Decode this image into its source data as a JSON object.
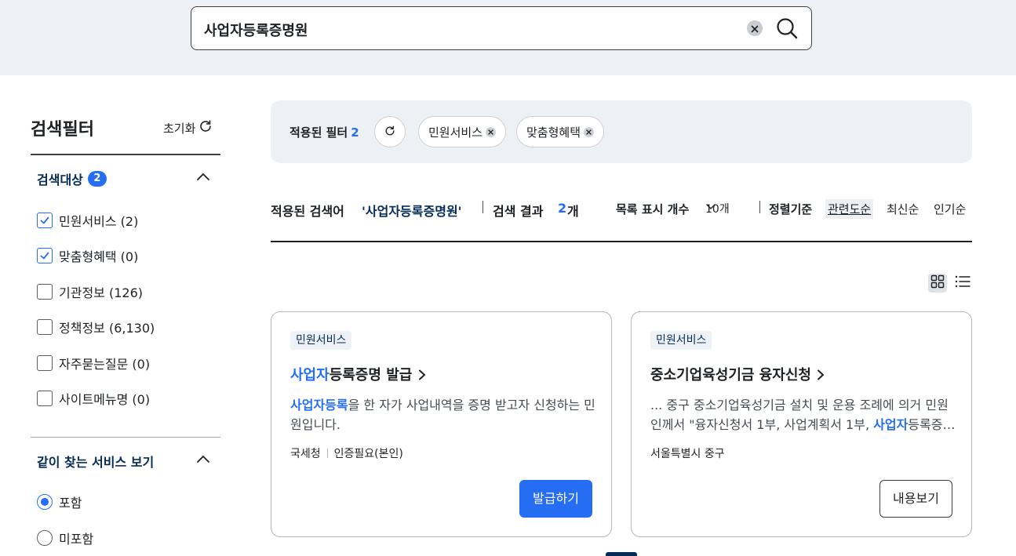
{
  "search": {
    "value": "사업자등록증명원"
  },
  "sidebar": {
    "title": "검색필터",
    "reset_label": "초기화",
    "target_section": {
      "title": "검색대상",
      "badge": "2",
      "items": [
        {
          "label": "민원서비스 (2)",
          "checked": true
        },
        {
          "label": "맞춤형혜택 (0)",
          "checked": true
        },
        {
          "label": "기관정보 (126)",
          "checked": false
        },
        {
          "label": "정책정보 (6,130)",
          "checked": false
        },
        {
          "label": "자주묻는질문 (0)",
          "checked": false
        },
        {
          "label": "사이트메뉴명 (0)",
          "checked": false
        }
      ]
    },
    "related_section": {
      "title": "같이 찾는 서비스 보기",
      "options": [
        {
          "label": "포함",
          "selected": true
        },
        {
          "label": "미포함",
          "selected": false
        }
      ]
    }
  },
  "applied_filters": {
    "label": "적용된 필터",
    "count": "2",
    "chips": [
      "민원서비스",
      "맞춤형혜택"
    ]
  },
  "results_bar": {
    "query_label": "적용된 검색어",
    "query_value": "'사업자등록증명원'",
    "result_label": "검색 결과",
    "result_count": "2",
    "result_unit": "개",
    "page_size_label": "목록 표시 개수",
    "page_size_value": "10개",
    "sort_label": "정렬기준",
    "sort_options": [
      "관련도순",
      "최신순",
      "인기순"
    ],
    "sort_active": "관련도순"
  },
  "cards": [
    {
      "tag": "민원서비스",
      "title_hl": "사업자",
      "title_rest": "등록증명 발급",
      "desc_hl": "사업자등록",
      "desc_rest": "을 한 자가 사업내역을 증명 받고자 신청하는 민원입니다.",
      "meta": [
        "국세청",
        "인증필요(본인)"
      ],
      "button": "발급하기"
    },
    {
      "tag": "민원서비스",
      "title": "중소기업육성기금 융자신청",
      "desc_pre": "... 중구 중소기업육성기금 설치 및 운용 조례에 의거 민원인께서 \"융자신청서 1부, 사업계획서 1부, ",
      "desc_hl": "사업자",
      "desc_post": "등록증…",
      "meta": [
        "서울특별시 중구"
      ],
      "button": "내용보기"
    }
  ],
  "colors": {
    "accent": "#256ef4",
    "navy": "#052b57",
    "band": "#edf0f4"
  }
}
